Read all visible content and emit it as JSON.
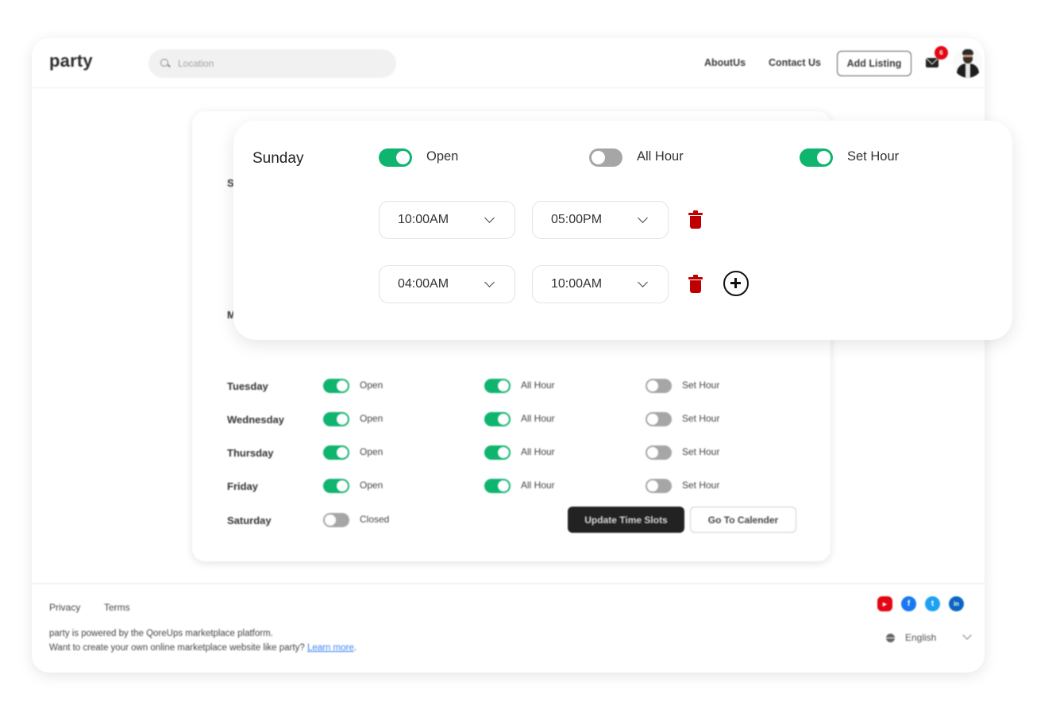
{
  "header": {
    "logo": "party",
    "search_placeholder": "Location",
    "nav": [
      {
        "label": "AboutUs"
      },
      {
        "label": "Contact Us"
      }
    ],
    "add_listing": "Add Listing",
    "notification_count": "6"
  },
  "schedule": {
    "rows": [
      {
        "day": "Tuesday",
        "open": true,
        "open_label": "Open",
        "all_hour": true,
        "all_hour_label": "All Hour",
        "set_hour": false,
        "set_hour_label": "Set Hour"
      },
      {
        "day": "Wednesday",
        "open": true,
        "open_label": "Open",
        "all_hour": true,
        "all_hour_label": "All Hour",
        "set_hour": false,
        "set_hour_label": "Set Hour"
      },
      {
        "day": "Thursday",
        "open": true,
        "open_label": "Open",
        "all_hour": true,
        "all_hour_label": "All Hour",
        "set_hour": false,
        "set_hour_label": "Set Hour"
      },
      {
        "day": "Friday",
        "open": true,
        "open_label": "Open",
        "all_hour": true,
        "all_hour_label": "All Hour",
        "set_hour": false,
        "set_hour_label": "Set Hour"
      },
      {
        "day": "Saturday",
        "open": false,
        "open_label": "Closed"
      }
    ],
    "partial_labels": [
      "S",
      "M"
    ],
    "update_button": "Update Time Slots",
    "calendar_button": "Go To Calender"
  },
  "popup": {
    "day": "Sunday",
    "open": true,
    "open_label": "Open",
    "all_hour": false,
    "all_hour_label": "All Hour",
    "set_hour": true,
    "set_hour_label": "Set Hour",
    "slots": [
      {
        "start": "10:00AM",
        "end": "05:00PM"
      },
      {
        "start": "04:00AM",
        "end": "10:00AM"
      }
    ]
  },
  "footer": {
    "links": [
      {
        "label": "Privacy"
      },
      {
        "label": "Terms"
      }
    ],
    "powered_text": "party is powered by the QoreUps marketplace platform.",
    "cta_text": "Want to create your own online marketplace website like party?",
    "learn_more": "Learn more",
    "cta_suffix": ".",
    "social": [
      {
        "name": "youtube",
        "color": "#e30613",
        "glyph": "▶"
      },
      {
        "name": "facebook",
        "color": "#1877f2",
        "glyph": "f"
      },
      {
        "name": "twitter",
        "color": "#1da1f2",
        "glyph": "t"
      },
      {
        "name": "linkedin",
        "color": "#0a66c2",
        "glyph": "in"
      }
    ],
    "language": "English"
  },
  "colors": {
    "toggle_on": "#0fb46e",
    "toggle_off": "#a6a6a6",
    "delete": "#c00000",
    "badge": "#e30613",
    "link": "#3b82f6"
  }
}
